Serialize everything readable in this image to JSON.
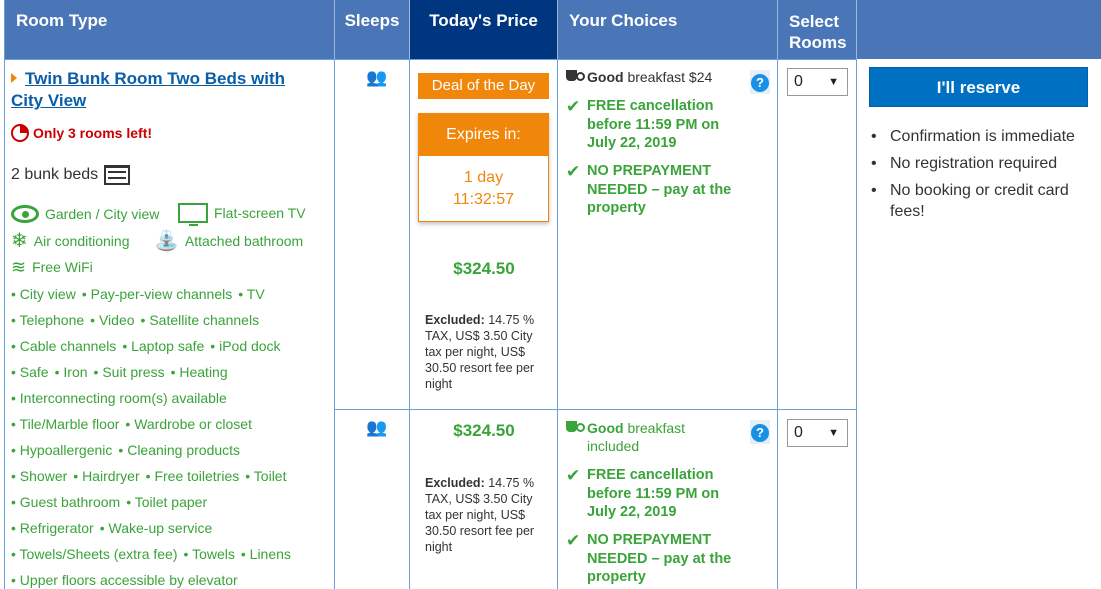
{
  "header": {
    "room_type": "Room Type",
    "sleeps": "Sleeps",
    "todays_price": "Today's Price",
    "your_choices": "Your Choices",
    "select_rooms": "Select Rooms"
  },
  "room": {
    "title": "Twin Bunk Room Two Beds with City View",
    "scarcity": "Only 3 rooms left!",
    "beds": "2 bunk beds",
    "facilities": [
      {
        "icon": "eye-icon",
        "label": "Garden / City view"
      },
      {
        "icon": "tv-icon",
        "label": "Flat-screen TV"
      },
      {
        "icon": "snowflake-icon",
        "label": "Air conditioning"
      },
      {
        "icon": "shower-icon",
        "label": "Attached bathroom"
      },
      {
        "icon": "wifi-icon",
        "label": "Free WiFi"
      }
    ],
    "amenity_lines": [
      [
        "City view",
        "Pay-per-view channels",
        "TV"
      ],
      [
        "Telephone",
        "Video",
        "Satellite channels"
      ],
      [
        "Cable channels",
        "Laptop safe",
        "iPod dock"
      ],
      [
        "Safe",
        "Iron",
        "Suit press",
        "Heating"
      ],
      [
        "Interconnecting room(s) available"
      ],
      [
        "Tile/Marble floor",
        "Wardrobe or closet"
      ],
      [
        "Hypoallergenic",
        "Cleaning products"
      ],
      [
        "Shower",
        "Hairdryer",
        "Free toiletries",
        "Toilet"
      ],
      [
        "Guest bathroom",
        "Toilet paper"
      ],
      [
        "Refrigerator",
        "Wake-up service"
      ],
      [
        "Towels/Sheets (extra fee)",
        "Towels",
        "Linens"
      ],
      [
        "Upper floors accessible by elevator"
      ]
    ]
  },
  "options": [
    {
      "deal_label": "Deal of the Day",
      "expires_label": "Expires in:",
      "expires_days": "1 day",
      "expires_time": "11:32:57",
      "price": "$324.50",
      "excluded_label": "Excluded:",
      "excluded_text": " 14.75 % TAX, US$ 3.50 City tax per night, US$ 30.50 resort fee per night",
      "breakfast_quality": "Good",
      "breakfast_text": "breakfast $24",
      "cancellation": "FREE cancellation before 11:59 PM on July 22, 2019",
      "prepayment": "NO PREPAYMENT NEEDED – pay at the property",
      "select_value": "0"
    },
    {
      "price": "$324.50",
      "excluded_label": "Excluded:",
      "excluded_text": " 14.75 % TAX, US$ 3.50 City tax per night, US$ 30.50 resort fee per night",
      "breakfast_quality": "Good",
      "breakfast_text": "breakfast included",
      "cancellation": "FREE cancellation before 11:59 PM on July 22, 2019",
      "prepayment": "NO PREPAYMENT NEEDED – pay at the property",
      "select_value": "0"
    }
  ],
  "reserve": {
    "button_label": "I'll reserve",
    "benefits": [
      "Confirmation is immediate",
      "No registration required",
      "No booking or credit card fees!"
    ]
  },
  "colors": {
    "header_bg": "#4a76b8",
    "price_header_bg": "#003580",
    "deal_orange": "#f0870a",
    "green": "#3aa33a",
    "link_blue": "#0a5ea8",
    "reserve_blue": "#0071c2",
    "alert_red": "#cc0000"
  }
}
